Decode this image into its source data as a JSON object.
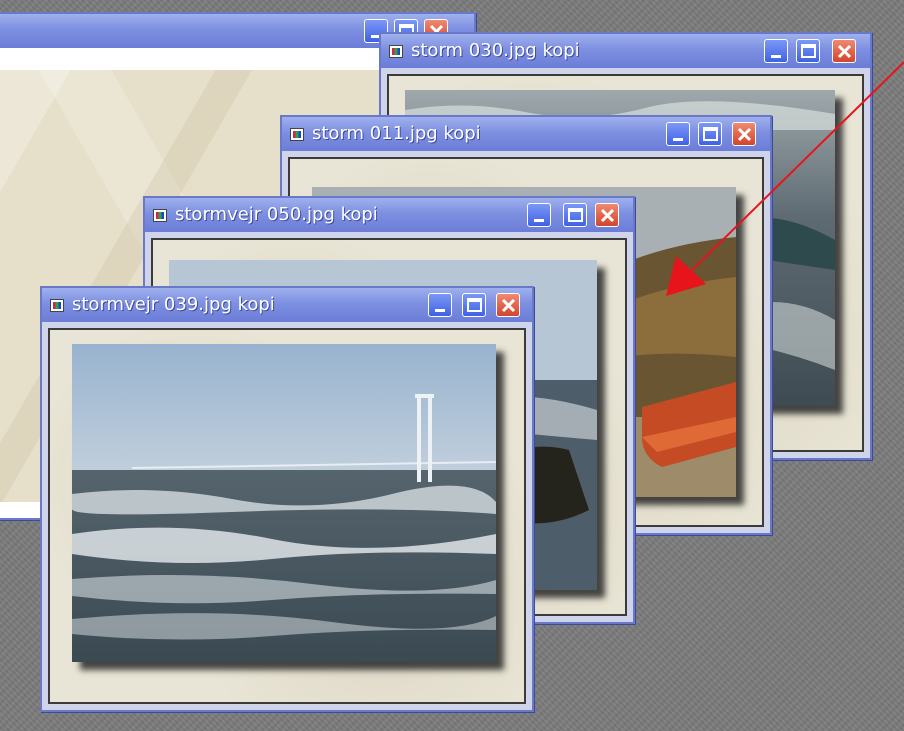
{
  "windows": [
    {
      "id": "paper",
      "title": ""
    },
    {
      "id": "storm030",
      "title": "storm 030.jpg kopi"
    },
    {
      "id": "storm011",
      "title": "storm 011.jpg kopi"
    },
    {
      "id": "stormvejr050",
      "title": "stormvejr 050.jpg kopi"
    },
    {
      "id": "stormvejr039",
      "title": "stormvejr 039.jpg kopi"
    }
  ],
  "window_buttons": {
    "minimize": "minimize",
    "maximize": "maximize",
    "close": "close"
  },
  "colors": {
    "desktop": "#7b7b7b",
    "titlebar": "#7d8fe0",
    "window_border": "#6a78c8",
    "close_button": "#d1452c",
    "annotation_arrow": "#e8141c"
  },
  "icons": [
    "image-file-icon",
    "minimize-icon",
    "maximize-icon",
    "close-icon"
  ]
}
